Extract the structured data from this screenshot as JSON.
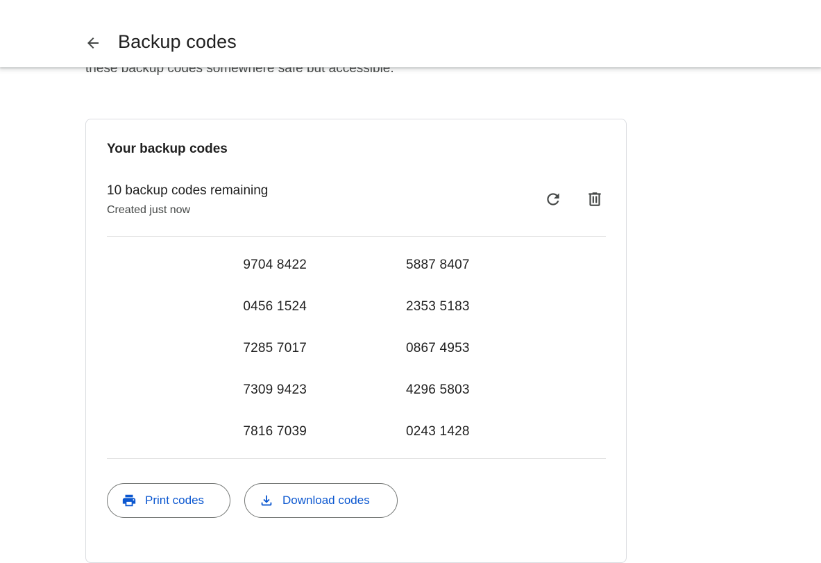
{
  "header": {
    "title": "Backup codes",
    "back_icon": "arrow-back-icon"
  },
  "intro": {
    "text": "these backup codes somewhere safe but accessible."
  },
  "card": {
    "title": "Your backup codes",
    "remaining": "10 backup codes remaining",
    "created": "Created just now",
    "refresh_icon": "refresh-icon",
    "delete_icon": "trash-icon",
    "codes": [
      [
        "9704 8422",
        "5887 8407"
      ],
      [
        "0456 1524",
        "2353 5183"
      ],
      [
        "7285 7017",
        "0867 4953"
      ],
      [
        "7309 9423",
        "4296 5803"
      ],
      [
        "7816 7039",
        "0243 1428"
      ]
    ],
    "print_label": "Print codes",
    "download_label": "Download codes"
  },
  "colors": {
    "accent": "#0b57d0",
    "text": "#1f1f1f",
    "secondary_text": "#444746",
    "border": "#dadce0"
  }
}
